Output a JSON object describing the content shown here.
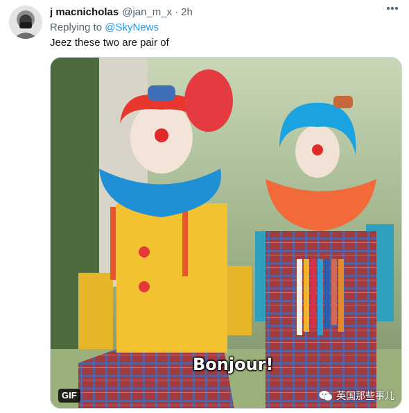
{
  "tweet": {
    "display_name": "j macnicholas",
    "handle": "@jan_m_x",
    "separator": "·",
    "time": "2h",
    "reply_prefix": "Replying to",
    "reply_to": "@SkyNews",
    "text": "Jeez these two are pair of"
  },
  "media": {
    "caption": "Bonjour!",
    "badge": "GIF",
    "watermark": "英国那些事儿"
  },
  "colors": {
    "link": "#1d9bf0",
    "secondary_text": "#536471",
    "primary_text": "#0f1419",
    "border": "#cfd9de"
  },
  "icons": [
    "avatar",
    "more-options-icon",
    "wechat-icon"
  ]
}
